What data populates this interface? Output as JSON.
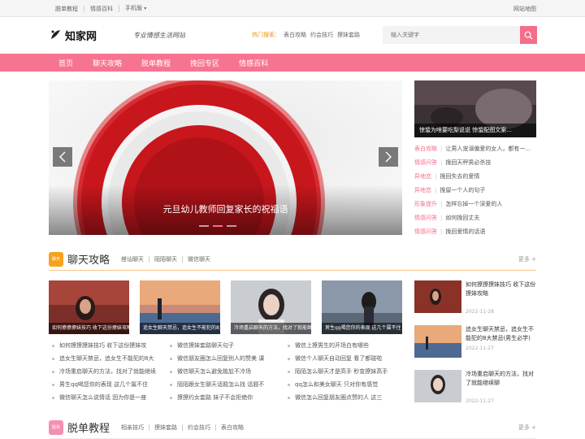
{
  "topbar": {
    "links": [
      "脱单教程",
      "情感百科",
      "手机版"
    ],
    "mobile_arrow": "▾",
    "sitemap": "网站地图"
  },
  "header": {
    "logo_text": "知家网",
    "slogan": "专业情感生活网站",
    "hot_label": "热门搜索：",
    "hot_items": [
      "表白攻略",
      "约会技巧",
      "撩妹套路"
    ],
    "search_placeholder": "输入关键字",
    "search_icon": "search-icon"
  },
  "nav": {
    "items": [
      "首页",
      "聊天攻略",
      "脱单教程",
      "挽回专区",
      "情感百科"
    ]
  },
  "slider": {
    "caption": "元旦幼儿教师回复家长的祝福语",
    "slide_count": 3,
    "active_index": 1
  },
  "side": {
    "feature_caption": "惊蛰为啥要吃梨说说 惊蛰配图文案...",
    "list": [
      {
        "cat": "表白攻略",
        "title": "让男人宠溺偏爱的女人，都有一..."
      },
      {
        "cat": "情感问答",
        "title": "挽回天秤男必杀技"
      },
      {
        "cat": "异地恋",
        "title": "挽回失去的爱情"
      },
      {
        "cat": "异地恋",
        "title": "挽留一个人的句子"
      },
      {
        "cat": "形象提升",
        "title": "怎样忘掉一个深爱的人"
      },
      {
        "cat": "情感问答",
        "title": "如何挽回丈夫"
      },
      {
        "cat": "情感问答",
        "title": "挽回爱情的话语"
      }
    ]
  },
  "section1": {
    "title": "聊天攻略",
    "badge_text": "聊天",
    "subs": [
      "搭讪聊天",
      "陌陌聊天",
      "微信聊天"
    ],
    "more": "更多 +",
    "cards": [
      "如何撩撩撩妹技巧 收下这份撩妹攻略",
      "追女生聊天禁忌，追女生不能犯的8大禁忌",
      "冷场重启聊天的方法，找对了就能继续聊",
      "男生qq喝您你的表现 这几个属不住"
    ],
    "columns": [
      [
        "如何撩撩撩妹技巧 收下这份撩妹攻",
        "追女生聊天禁忌，追女生不能犯的8大",
        "冷场重启聊天的方法，找对了就能继续",
        "男生qq喝您你的表现 这几个属不住",
        "微信聊天怎么说情话 因为你是一座"
      ],
      [
        "微信撩妹套路聊天句子",
        "微信朋友圈怎么回复别人的赞美 课",
        "微信聊天怎么避免尴尬不冷场",
        "陌陌跟女生聊天话题怎么找 话题不",
        "撩撩约女套路 妹子不会拒绝你"
      ],
      [
        "微信上撩男生的开场白有哪些",
        "微信个人聊天自动回复 看了都碰啦",
        "陌陌怎么聊天才是高手 秒变撩妹高手",
        "qq怎么和美女聊天 只对你有感觉",
        "微信怎么回复朋友圈点赞的人 这三"
      ]
    ],
    "right_items": [
      {
        "title": "如何撩撩撩妹技巧 收下这份撩妹攻略",
        "date": "2022-11-28"
      },
      {
        "title": "追女生聊天禁忌，追女生不能犯的8大禁忌(男生必学)",
        "date": "2022-11-27"
      },
      {
        "title": "冷场重启聊天的方法，找对了就能继续聊",
        "date": "2022-11-27"
      }
    ]
  },
  "section2": {
    "title": "脱单教程",
    "badge_text": "脱单",
    "subs": [
      "相亲技巧",
      "撩妹套路",
      "约会技巧",
      "表白攻略"
    ],
    "more": "更多 +"
  },
  "colors": {
    "brand_pink": "#f77490",
    "accent_pink": "#f46e8a",
    "hot_orange": "#f0941c",
    "badge_orange": "#f7a21b",
    "badge_pink": "#f58fb0"
  }
}
